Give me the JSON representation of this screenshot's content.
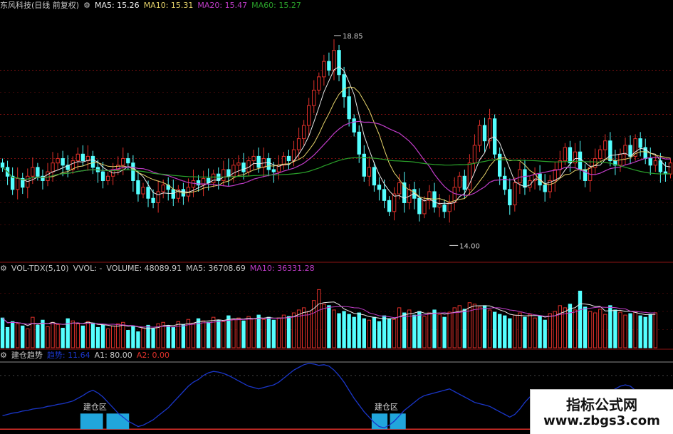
{
  "colors": {
    "up": "#e0302a",
    "down": "#54ffff",
    "ma5": "#e8e8e8",
    "ma10": "#e6d36a",
    "ma20": "#c03cc8",
    "ma60": "#2aa02a",
    "grid": "#7a0f0f",
    "accent": "#1a36c8"
  },
  "header_main": {
    "icon": "circle-icon",
    "name": "东风科技(日线 前复权)",
    "ma5": "MA5: 15.26",
    "ma10": "MA10: 15.31",
    "ma20": "MA20: 15.47",
    "ma60": "MA60: 15.27"
  },
  "header_vol": {
    "name": "VOL-TDX(5,10)",
    "vvol": "VVOL: -",
    "volume": "VOLUME: 48089.91",
    "ma5": "MA5: 36708.69",
    "ma10": "MA10: 36331.28"
  },
  "header_ind": {
    "name": "建仓趋势",
    "trend": "趋势: 11.64",
    "a1": "A1: 80.00",
    "a2": "A2: 0.00"
  },
  "watermark": {
    "line1": "指标公式网",
    "line2": "www.zbgs3.com"
  },
  "chart_data": [
    {
      "type": "candlestick",
      "title": "东风科技(日线 前复权)",
      "ylim": [
        13.7,
        19.3
      ],
      "annotations": [
        {
          "label": "18.85",
          "value": 18.85,
          "kind": "high"
        },
        {
          "label": "14.00",
          "value": 14.0,
          "kind": "low"
        }
      ],
      "series_labels": [
        "MA5: 15.26",
        "MA10: 15.31",
        "MA20: 15.47",
        "MA60: 15.27"
      ],
      "closes": [
        15.8,
        15.6,
        15.3,
        15.55,
        15.35,
        15.6,
        15.8,
        15.6,
        15.5,
        15.7,
        15.9,
        16.0,
        15.85,
        15.75,
        15.95,
        16.1,
        15.95,
        16.05,
        15.8,
        15.7,
        15.5,
        15.6,
        15.75,
        15.85,
        16.0,
        15.9,
        15.5,
        15.2,
        15.35,
        15.1,
        15.0,
        15.25,
        15.4,
        15.3,
        15.1,
        15.3,
        15.15,
        15.35,
        15.5,
        15.4,
        15.55,
        15.45,
        15.65,
        15.5,
        15.75,
        15.6,
        15.85,
        15.9,
        15.7,
        15.95,
        16.05,
        15.8,
        16.0,
        15.75,
        15.7,
        15.85,
        16.05,
        15.95,
        16.2,
        16.45,
        16.75,
        17.2,
        17.55,
        17.85,
        18.2,
        18.0,
        18.45,
        17.9,
        17.4,
        16.9,
        16.6,
        16.1,
        15.6,
        15.8,
        15.4,
        15.3,
        15.05,
        14.8,
        15.2,
        15.45,
        15.0,
        15.3,
        15.1,
        14.75,
        15.05,
        15.25,
        14.9,
        14.95,
        14.8,
        15.0,
        15.35,
        15.6,
        15.3,
        15.9,
        16.3,
        16.75,
        16.4,
        16.9,
        16.1,
        15.6,
        15.3,
        14.95,
        15.45,
        15.75,
        15.35,
        15.5,
        15.65,
        15.4,
        15.25,
        15.5,
        15.75,
        15.95,
        16.25,
        15.9,
        16.15,
        15.75,
        15.5,
        15.8,
        16.0,
        16.2,
        16.4,
        15.95,
        15.85,
        16.1,
        16.3,
        16.05,
        16.45,
        16.25,
        16.0,
        15.85,
        15.95,
        15.7,
        15.65,
        15.9
      ],
      "volumes": [
        41000,
        28000,
        36000,
        33000,
        30000,
        26000,
        42000,
        31000,
        38000,
        29000,
        35000,
        32000,
        27000,
        40000,
        37000,
        33000,
        30000,
        36000,
        34000,
        28000,
        31000,
        26000,
        30000,
        33000,
        35000,
        24000,
        29000,
        22000,
        27000,
        31000,
        26000,
        33000,
        35000,
        30000,
        28000,
        36000,
        32000,
        39000,
        34000,
        40000,
        37000,
        35000,
        42000,
        38000,
        36000,
        44000,
        39000,
        41000,
        37000,
        43000,
        40000,
        45000,
        39000,
        42000,
        38000,
        41000,
        45000,
        43000,
        48000,
        52000,
        55000,
        50000,
        65000,
        80000,
        60000,
        58000,
        52000,
        47000,
        50000,
        46000,
        42000,
        48000,
        40000,
        38000,
        42000,
        36000,
        44000,
        40000,
        39000,
        55000,
        48000,
        52000,
        45000,
        50000,
        43000,
        48000,
        52000,
        46000,
        42000,
        49000,
        55000,
        58000,
        53000,
        62000,
        60000,
        56000,
        58000,
        52000,
        49000,
        46000,
        44000,
        40000,
        45000,
        48000,
        42000,
        46000,
        41000,
        44000,
        38000,
        47000,
        50000,
        58000,
        55000,
        60000,
        52000,
        78000,
        56000,
        50000,
        48000,
        53000,
        46000,
        58000,
        52000,
        49000,
        45000,
        47000,
        50000,
        44000,
        42000,
        46000,
        48089
      ],
      "vol_ylim": [
        0,
        100000
      ],
      "indicator": {
        "name": "建仓趋势",
        "trend_last": 11.64,
        "a1": 80.0,
        "a2": 0.0,
        "ylim": [
          -5,
          100
        ],
        "values": [
          20,
          22,
          24,
          25,
          27,
          28,
          30,
          31,
          32,
          34,
          35,
          37,
          38,
          40,
          42,
          46,
          50,
          55,
          58,
          54,
          48,
          40,
          32,
          24,
          18,
          12,
          8,
          4,
          6,
          10,
          14,
          20,
          26,
          32,
          40,
          48,
          56,
          64,
          70,
          74,
          80,
          84,
          86,
          85,
          83,
          80,
          76,
          72,
          68,
          64,
          62,
          60,
          62,
          64,
          66,
          70,
          76,
          82,
          88,
          92,
          96,
          98,
          97,
          95,
          96,
          94,
          88,
          80,
          70,
          58,
          46,
          36,
          26,
          18,
          10,
          4,
          2,
          6,
          12,
          20,
          28,
          34,
          40,
          46,
          50,
          52,
          54,
          56,
          58,
          60,
          56,
          52,
          48,
          44,
          40,
          38,
          36,
          34,
          30,
          26,
          22,
          18,
          22,
          30,
          40,
          48,
          52,
          54,
          56,
          55,
          52,
          48,
          44,
          38,
          36,
          34,
          36,
          38,
          40,
          44,
          50,
          56,
          60,
          64,
          66,
          64,
          58,
          50,
          42,
          34,
          28,
          20
        ],
        "zones": [
          {
            "label": "建仓区",
            "start": 16,
            "end": 25
          },
          {
            "label": "建仓区",
            "start": 74,
            "end": 80
          }
        ]
      }
    }
  ]
}
